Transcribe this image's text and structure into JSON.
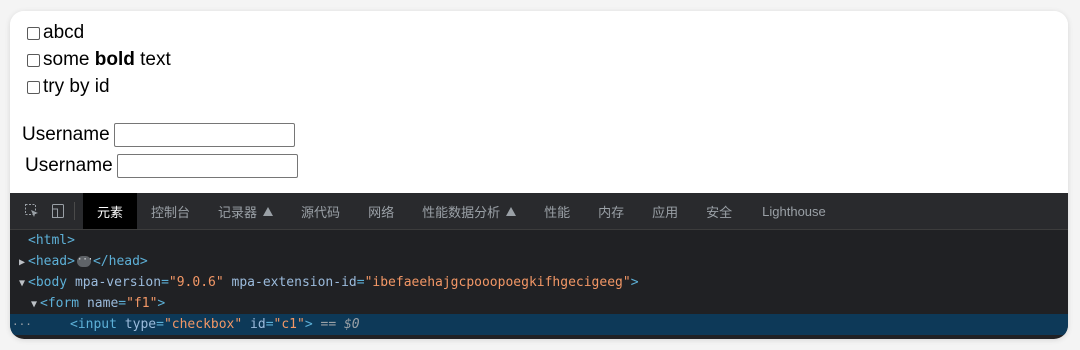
{
  "page": {
    "checkboxes": [
      {
        "label": "abcd"
      },
      {
        "label_pre": "some ",
        "label_bold": "bold",
        "label_post": " text"
      },
      {
        "label": "try by id"
      }
    ],
    "fields": [
      {
        "label": "Username",
        "value": ""
      },
      {
        "label": "Username",
        "value": ""
      }
    ]
  },
  "devtools": {
    "tabs": [
      {
        "label": "元素",
        "active": true
      },
      {
        "label": "控制台"
      },
      {
        "label": "记录器",
        "icon": "flask-icon"
      },
      {
        "label": "源代码"
      },
      {
        "label": "网络"
      },
      {
        "label": "性能数据分析",
        "icon": "flask-icon"
      },
      {
        "label": "性能"
      },
      {
        "label": "内存"
      },
      {
        "label": "应用"
      },
      {
        "label": "安全"
      },
      {
        "label": "Lighthouse"
      }
    ],
    "dom": {
      "html_tag": "<html>",
      "head_open": "<head>",
      "head_close": "</head>",
      "body_open": "<body",
      "body_attr1_name": "mpa-version",
      "body_attr1_val": "\"9.0.6\"",
      "body_attr2_name": "mpa-extension-id",
      "body_attr2_val": "\"ibefaeehajgcpooopoegkifhgecigeeg\"",
      "form_open": "<form",
      "form_attr_name": "name",
      "form_attr_val": "\"f1\"",
      "input_open": "<input",
      "input_attr1_name": "type",
      "input_attr1_val": "\"checkbox\"",
      "input_attr2_name": "id",
      "input_attr2_val": "\"c1\"",
      "selected_suffix": "== $0"
    }
  }
}
